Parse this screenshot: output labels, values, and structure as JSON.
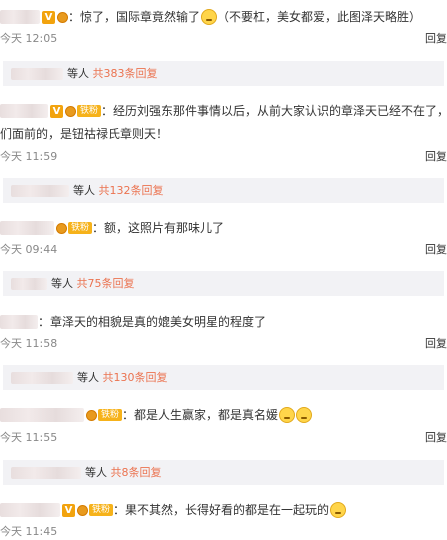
{
  "comments": [
    {
      "badge_v": "V",
      "fan_label": "",
      "text": "：惊了，国际章竟然输了",
      "text2": "（不要杠，美女都爱，此图泽天略胜）",
      "time": "今天 12:05",
      "reply_action": "回复"
    },
    {
      "badge_v": "V",
      "fan_label": "铁粉",
      "text": "：经历刘强东那件事情以后，从前大家认识的章泽天已经不在了，",
      "wrap": "们面前的，是钮祜禄氏章则天！",
      "time": "今天 11:59",
      "reply_action": "回复"
    },
    {
      "badge_v": "",
      "fan_label": "铁粉",
      "text": "：额，这照片有那味儿了",
      "time": "今天 09:44",
      "reply_action": "回复"
    },
    {
      "badge_v": "",
      "fan_label": "",
      "text": "：章泽天的相貌是真的媲美女明星的程度了",
      "time": "今天 11:58",
      "reply_action": "回复"
    },
    {
      "badge_v": "",
      "fan_label": "铁粉",
      "text": "：都是人生赢家，都是真名媛",
      "time": "今天 11:55",
      "reply_action": "回复"
    },
    {
      "badge_v": "V",
      "fan_label": "铁粉",
      "text": "：果不其然，长得好看的都是在一起玩的",
      "time": "今天 11:45",
      "reply_action": ""
    }
  ],
  "reply_bars": [
    {
      "prefix": "等人",
      "count": "共383条回复"
    },
    {
      "prefix": "等人",
      "count": "共132条回复"
    },
    {
      "prefix": "等人",
      "count": "共75条回复"
    },
    {
      "prefix": "等人",
      "count": "共130条回复"
    },
    {
      "prefix": "等人",
      "count": "共8条回复"
    }
  ],
  "colors": {
    "accent": "#eb7350",
    "badge": "#f2a30e",
    "fan": "#f6b21a"
  }
}
